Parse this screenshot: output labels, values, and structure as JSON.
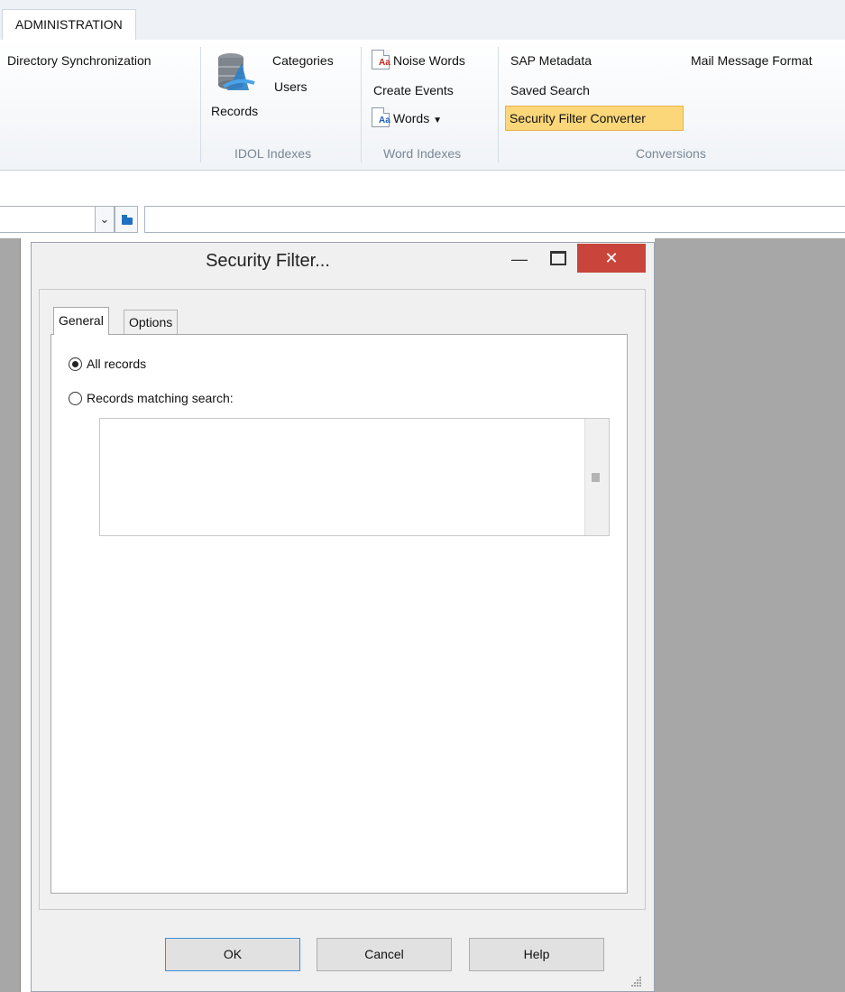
{
  "ribbon": {
    "tab_label": "ADMINISTRATION",
    "directory_sync": "Directory Synchronization",
    "records_label": "Records",
    "categories_label": "Categories",
    "users_label": "Users",
    "idol_indexes_group": "IDOL Indexes",
    "noise_words_label": "Noise Words",
    "create_events_label": "Create Events",
    "words_label": "Words",
    "word_indexes_group": "Word Indexes",
    "sap_metadata_label": "SAP Metadata",
    "saved_search_label": "Saved Search",
    "security_filter_converter_label": "Security Filter Converter",
    "mail_message_format_label": "Mail Message Format",
    "conversions_group": "Conversions"
  },
  "icons": {
    "records": "database-records-icon",
    "noise_words": "noise-words-icon",
    "words": "words-icon",
    "dropdown": "chevron-down-icon",
    "folder": "folder-icon",
    "close": "close-icon",
    "minimize": "minimize-icon",
    "maximize": "maximize-icon"
  },
  "dialog": {
    "title": "Security Filter...",
    "tabs": [
      {
        "label": "General",
        "active": true
      },
      {
        "label": "Options",
        "active": false
      }
    ],
    "radio_all_records": "All records",
    "radio_matching_search": "Records matching search:",
    "selected_option": "All records",
    "search_text": "",
    "ok_label": "OK",
    "cancel_label": "Cancel",
    "help_label": "Help"
  },
  "colors": {
    "highlight": "#fbd77a",
    "close_button": "#c9453b",
    "workspace": "#a7a7a7"
  }
}
